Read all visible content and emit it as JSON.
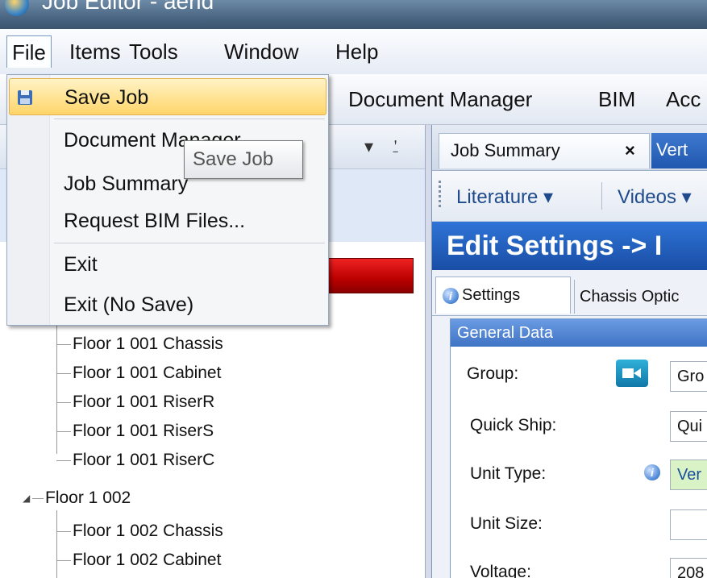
{
  "window": {
    "title": "Job Editor - aerid"
  },
  "menubar": {
    "items": [
      {
        "label": "File"
      },
      {
        "label": "Items"
      },
      {
        "label": "Tools"
      },
      {
        "label": "Window"
      },
      {
        "label": "Help"
      }
    ]
  },
  "toolbar": {
    "items": [
      {
        "label": "Document Manager"
      },
      {
        "label": "BIM"
      },
      {
        "label": "Acc"
      }
    ]
  },
  "file_menu": {
    "items": [
      {
        "label": "Save Job"
      },
      {
        "label": "Document Manager"
      },
      {
        "label": "Job Summary"
      },
      {
        "label": "Request BIM Files..."
      },
      {
        "label": "Exit"
      },
      {
        "label": "Exit (No Save)"
      }
    ],
    "tooltip": "Save Job"
  },
  "tree": {
    "rows": [
      {
        "label": "Floor 1 001 Chassis"
      },
      {
        "label": "Floor 1 001 Cabinet"
      },
      {
        "label": "Floor 1 001 RiserR"
      },
      {
        "label": "Floor 1 001 RiserS"
      },
      {
        "label": "Floor 1 001 RiserC"
      },
      {
        "label": "Floor 1 002"
      },
      {
        "label": "Floor 1 002 Chassis"
      },
      {
        "label": "Floor 1 002 Cabinet"
      }
    ]
  },
  "right_panel": {
    "tabs": [
      {
        "label": "Job Summary",
        "close": "×"
      },
      {
        "label": "Vert"
      }
    ],
    "tools": [
      {
        "label": "Literature ▾"
      },
      {
        "label": "Videos ▾"
      }
    ],
    "heading": "Edit Settings -> I",
    "subtabs": [
      {
        "label": "Settings"
      },
      {
        "label": "Chassis Optic"
      }
    ],
    "general_data": {
      "title": "General Data",
      "rows": [
        {
          "label": "Group:",
          "value": "Gro"
        },
        {
          "label": "Quick Ship:",
          "value": "Qui"
        },
        {
          "label": "Unit Type:",
          "value": "Ver"
        },
        {
          "label": "Unit Size:",
          "value": ""
        },
        {
          "label": "Voltage:",
          "value": "208"
        }
      ]
    }
  },
  "colors": {
    "menu_highlight": "#ffd56a",
    "heading_bg": "#1a4ea6",
    "red_bar": "#cc0000",
    "unit_type_field": "#d9f3c7"
  }
}
